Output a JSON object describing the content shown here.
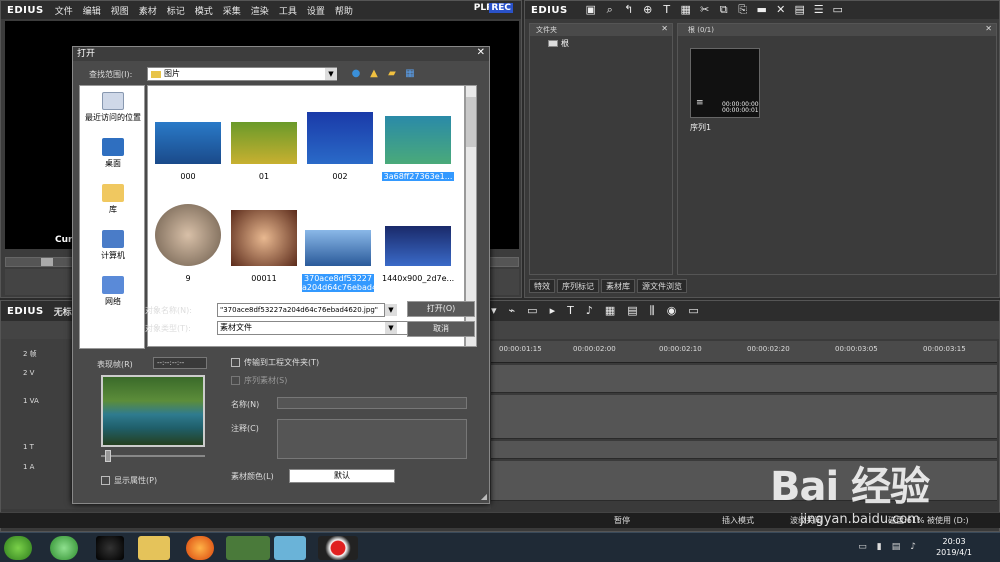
{
  "player": {
    "logo": "EDIUS",
    "menu": [
      "文件",
      "编辑",
      "视图",
      "素材",
      "标记",
      "模式",
      "采集",
      "渲染",
      "工具",
      "设置",
      "帮助"
    ],
    "plr": "PLR",
    "rec": "REC",
    "cur_label": "Cur"
  },
  "bin": {
    "logo": "EDIUS",
    "folder_header": "文件夹",
    "folder_root": "根",
    "clip_header": "根 (0/1)",
    "clip_tc": "00:00:00:00\n00:00:00:01",
    "clip_name": "序列1",
    "tabs": [
      "特效",
      "序列标记",
      "素材库",
      "源文件浏览"
    ]
  },
  "timeline": {
    "logo": "EDIUS",
    "title": "无标题",
    "ticks": [
      "00:00:01:15",
      "00:00:02:00",
      "00:00:02:10",
      "00:00:02:20",
      "00:00:03:05",
      "00:00:03:15"
    ],
    "tracks": [
      "2 V",
      "1 VA",
      "1 T",
      "1 A"
    ],
    "track_ch": "2 帧"
  },
  "status": {
    "pause": "暂停",
    "insert_mode": "插入模式",
    "ripple": "波纹关闭",
    "disk": "磁盘:61% 被使用 (D:)"
  },
  "taskbar": {
    "time": "20:03",
    "date": "2019/4/1"
  },
  "dialog": {
    "title": "打开",
    "lookin_label": "查找范围(I):",
    "lookin_value": "图片",
    "places": [
      {
        "label": "最近访问的位置"
      },
      {
        "label": "桌面"
      },
      {
        "label": "库"
      },
      {
        "label": "计算机"
      },
      {
        "label": "网络"
      }
    ],
    "files": [
      {
        "label": "000"
      },
      {
        "label": "01"
      },
      {
        "label": "002"
      },
      {
        "label": "3a68ff27363e1..."
      },
      {
        "label": "9"
      },
      {
        "label": "00011"
      },
      {
        "label": "370ace8df53227\na204d64c76ebad4..."
      },
      {
        "label": "1440x900_2d7e..."
      }
    ],
    "filename_label": "对象名称(N):",
    "filename_value": "\"370ace8df53227a204d64c76ebad4620.jpg\"",
    "filetype_label": "对象类型(T):",
    "filetype_value": "素材文件",
    "open_label": "打开(O)",
    "cancel_label": "取消",
    "preview_label": "表现帧(R)",
    "tc_value": "--:--:--:--",
    "transfer_label": "传输到工程文件夹(T)",
    "seq_label": "序列素材(S)",
    "name_label": "名称(N)",
    "note_label": "注释(C)",
    "color_label": "素材颜色(L)",
    "color_value": "默认",
    "showprop_label": "显示属性(P)"
  },
  "watermark": {
    "text": "Bai 经验",
    "url": "jingyan.baidu.com"
  }
}
